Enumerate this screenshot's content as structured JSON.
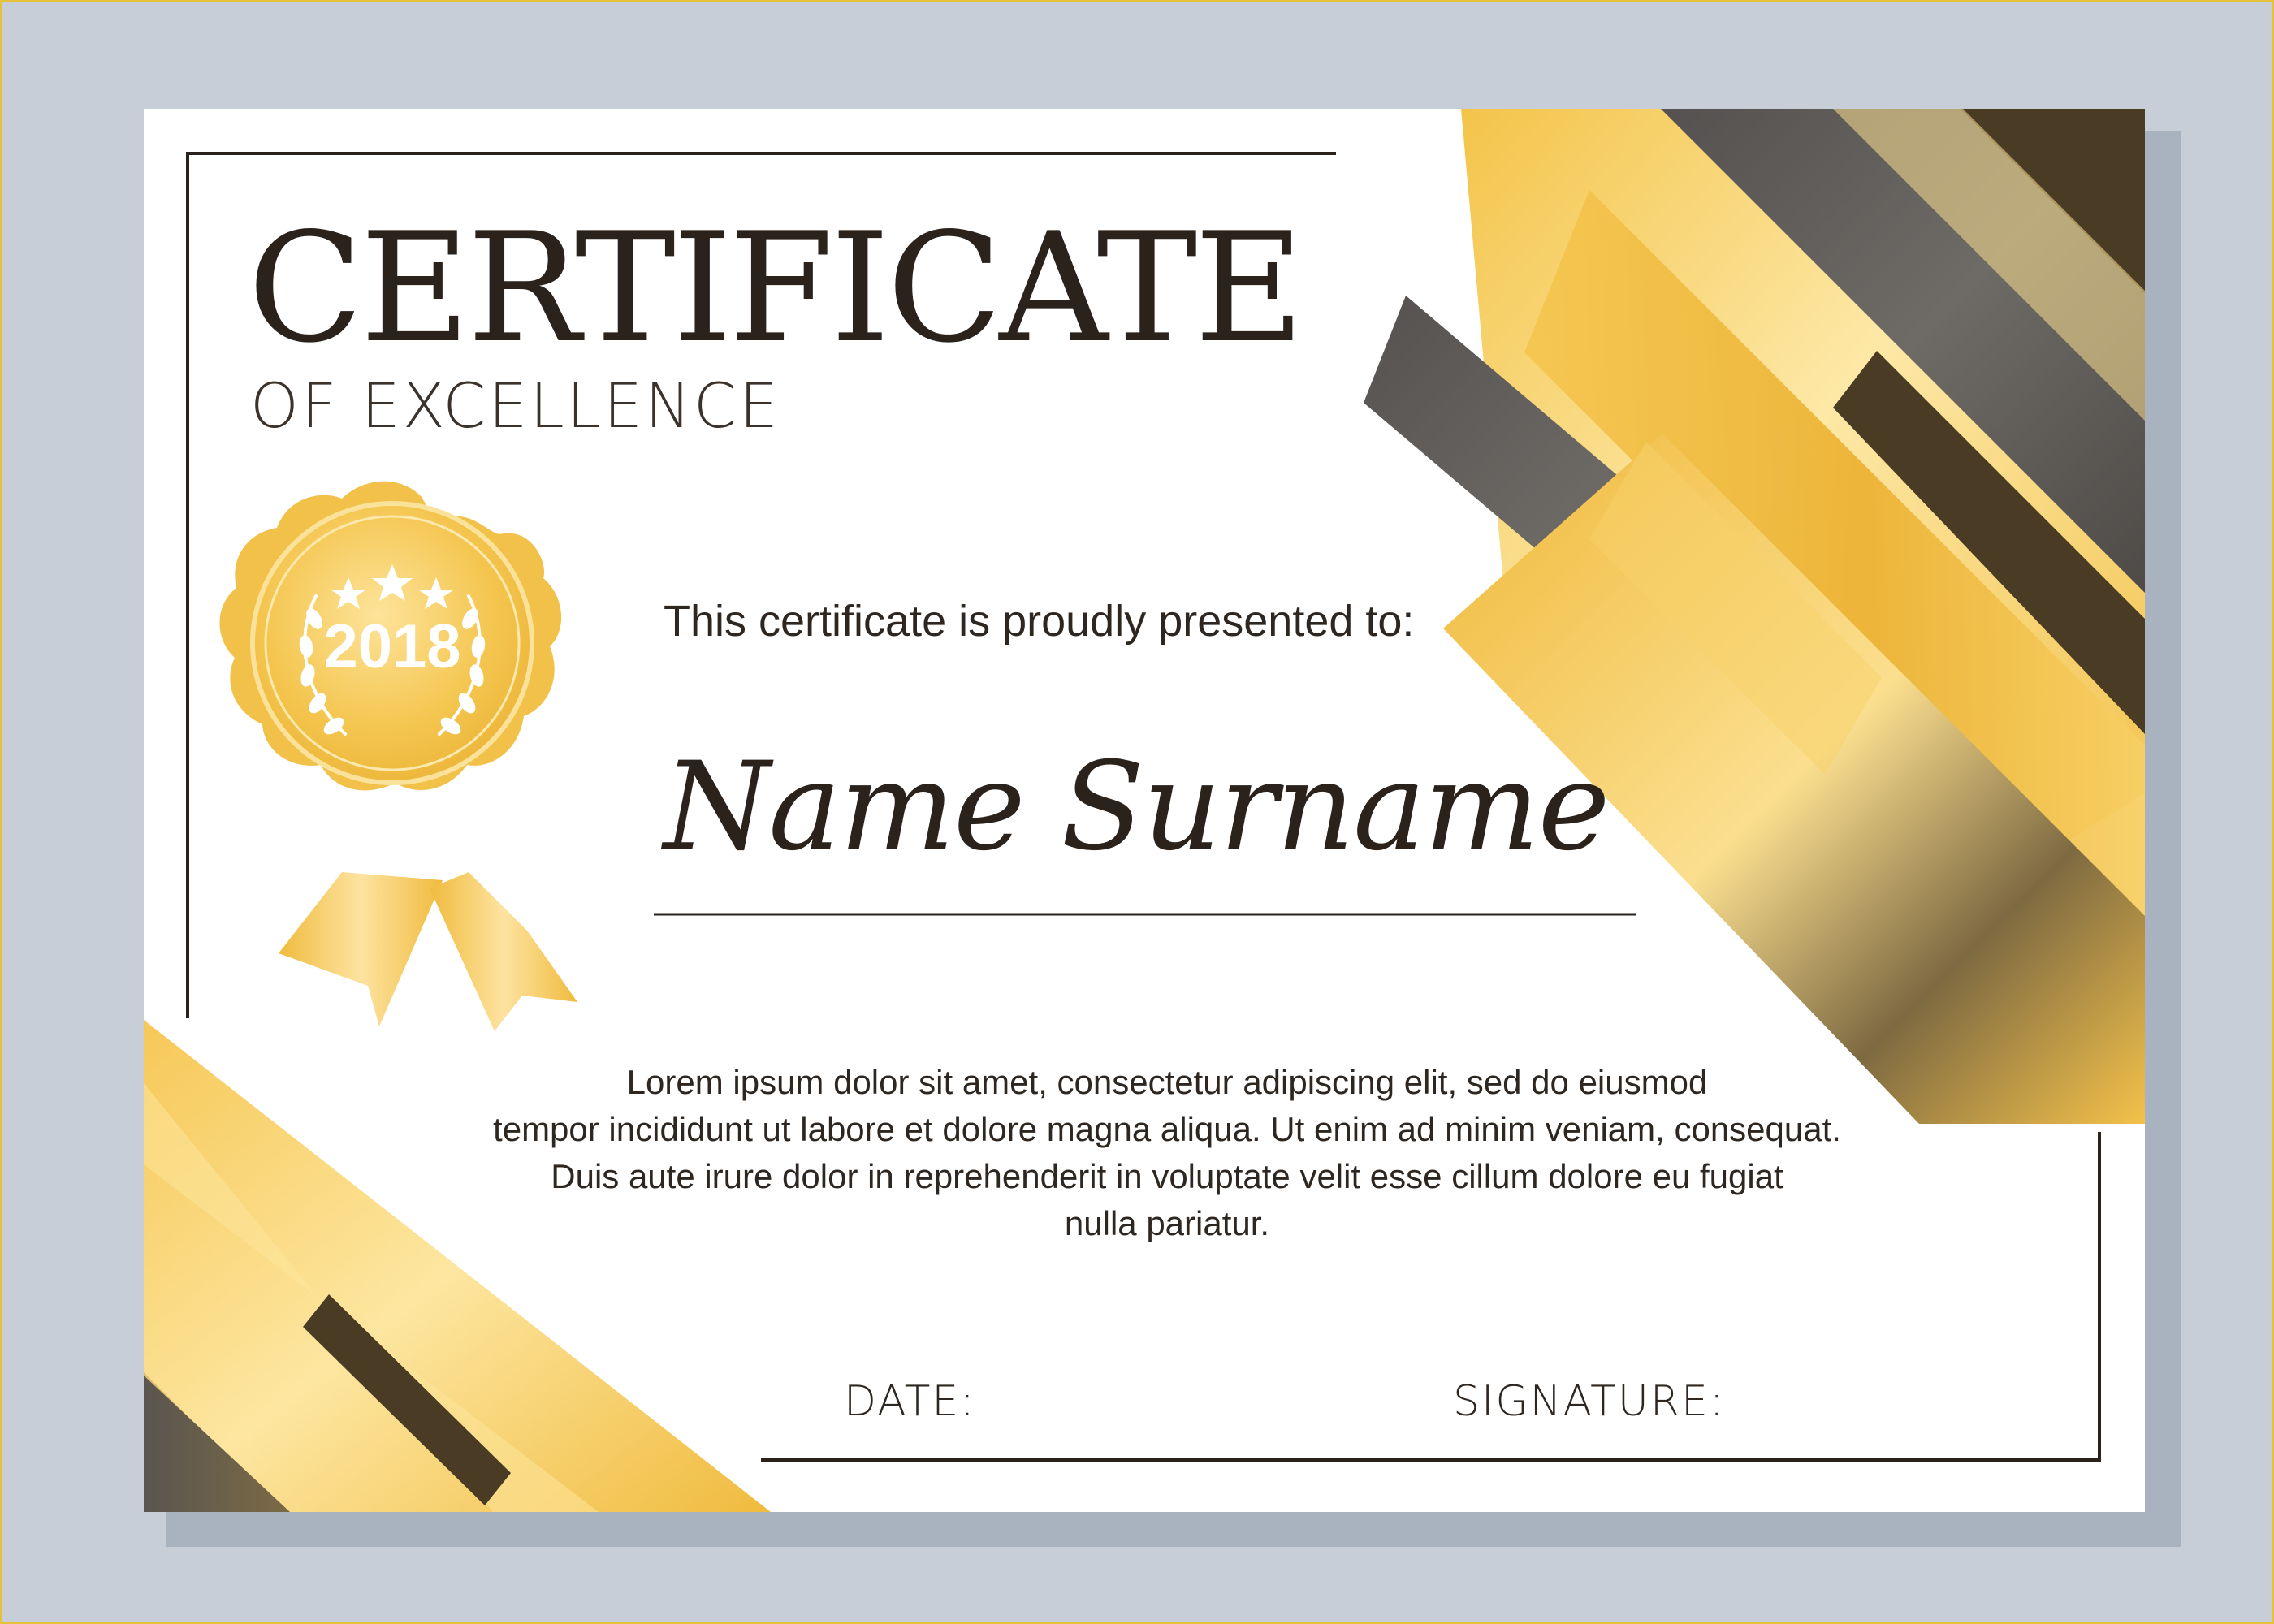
{
  "certificate": {
    "title": "CERTIFICATE",
    "subtitle": "OF EXCELLENCE",
    "presented_to": "This certificate is proudly presented to:",
    "recipient": "Name Surname",
    "body_lines": [
      "Lorem ipsum dolor sit amet, consectetur adipiscing elit, sed do eiusmod",
      "tempor incididunt ut labore et dolore magna aliqua. Ut enim ad minim veniam, consequat.",
      "Duis aute irure dolor in reprehenderit in voluptate velit esse cillum dolore eu fugiat",
      "nulla pariatur."
    ],
    "date_label": "DATE:",
    "signature_label": "SIGNATURE:"
  },
  "badge": {
    "year": "2018",
    "star_count": 3
  },
  "colors": {
    "gold": "#f0bc3c",
    "gold_light": "#fde59a",
    "dark_gray": "#5b5654",
    "dark_brown": "#4a3b24",
    "ink": "#2a221b",
    "background": "#c8ced8"
  }
}
